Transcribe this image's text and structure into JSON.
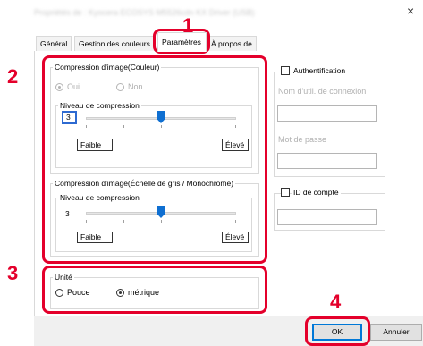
{
  "window": {
    "title": "Propriétés de : Kyocera ECOSYS M5526cdn KX Driver (USB)",
    "close_glyph": "×"
  },
  "tabs": [
    {
      "label": "Général"
    },
    {
      "label": "Gestion des couleurs"
    },
    {
      "label": "Paramètres"
    },
    {
      "label": "À propos de"
    }
  ],
  "color_compression": {
    "legend": "Compression d'image(Couleur)",
    "radio_on": "Oui",
    "radio_off": "Non",
    "level_legend": "Niveau de compression",
    "value": "3",
    "low_label": "Faible",
    "high_label": "Élevé",
    "level": 3
  },
  "gray_compression": {
    "legend": "Compression d'image(Échelle de gris / Monochrome)",
    "level_legend": "Niveau de compression",
    "value": "3",
    "low_label": "Faible",
    "high_label": "Élevé",
    "level": 3
  },
  "unit": {
    "legend": "Unité",
    "option_inch": "Pouce",
    "option_metric": "métrique",
    "selected": "métrique"
  },
  "authentication": {
    "label": "Authentification",
    "username_label": "Nom d'util. de connexion",
    "password_label": "Mot de passe"
  },
  "account": {
    "label": "ID de compte"
  },
  "buttons": {
    "ok": "OK",
    "cancel": "Annuler"
  },
  "callouts": [
    "1",
    "2",
    "3",
    "4"
  ],
  "colors": {
    "highlight": "#e4002b",
    "slider": "#0f6fd1"
  }
}
